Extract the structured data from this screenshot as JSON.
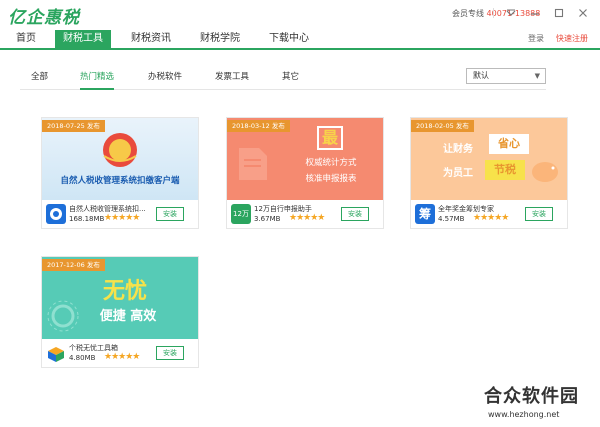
{
  "app": {
    "logo_text": "亿企惠税"
  },
  "titlebar": {
    "hotline_label": "会员专线",
    "hotline_number": "40071-13888"
  },
  "nav": {
    "tabs": [
      {
        "label": "首页"
      },
      {
        "label": "财税工具"
      },
      {
        "label": "财税资讯"
      },
      {
        "label": "财税学院"
      },
      {
        "label": "下载中心"
      }
    ],
    "active_index": 1,
    "login": "登录",
    "register": "快速注册"
  },
  "filters": {
    "items": [
      {
        "label": "全部"
      },
      {
        "label": "热门精选"
      },
      {
        "label": "办税软件"
      },
      {
        "label": "发票工具"
      },
      {
        "label": "其它"
      }
    ],
    "active_index": 1,
    "sort_selected": "默认"
  },
  "cards": [
    {
      "date": "2018-07-25 发布",
      "banner_text": "自然人税收管理系统扣缴客户端",
      "name": "自然人税收管理系统扣...",
      "size": "168.18MB",
      "stars": "★★★★★",
      "install": "安装",
      "icon_color": "#1e6fd9"
    },
    {
      "date": "2018-03-12 发布",
      "banner_big": "最",
      "banner_line1": "权威统计方式",
      "banner_line2": "核准申报报表",
      "name": "12万自行申报助手",
      "size": "3.67MB",
      "stars": "★★★★★",
      "install": "安装",
      "icon_label": "12万",
      "icon_color": "#2ba55f"
    },
    {
      "date": "2018-02-05 发布",
      "banner_a": "让财务",
      "banner_b": "省心",
      "banner_c": "为员工",
      "banner_d": "节税",
      "name": "全年奖金筹划专家",
      "size": "4.57MB",
      "stars": "★★★★★",
      "install": "安装",
      "icon_label": "筹",
      "icon_color": "#1e6fd9"
    },
    {
      "date": "2017-12-06 发布",
      "banner_a": "无忧",
      "banner_b": "便捷 高效",
      "name": "个税无忧工具箱",
      "size": "4.80MB",
      "stars": "★★★★★",
      "install": "安装",
      "icon_color": "#f5a623"
    }
  ],
  "watermark": {
    "name": "合众软件园",
    "url": "www.hezhong.net"
  },
  "colors": {
    "brand_green": "#2ba55f",
    "accent_red": "#e94b3c",
    "date_tag": "#e8962f",
    "star": "#f5a623"
  }
}
